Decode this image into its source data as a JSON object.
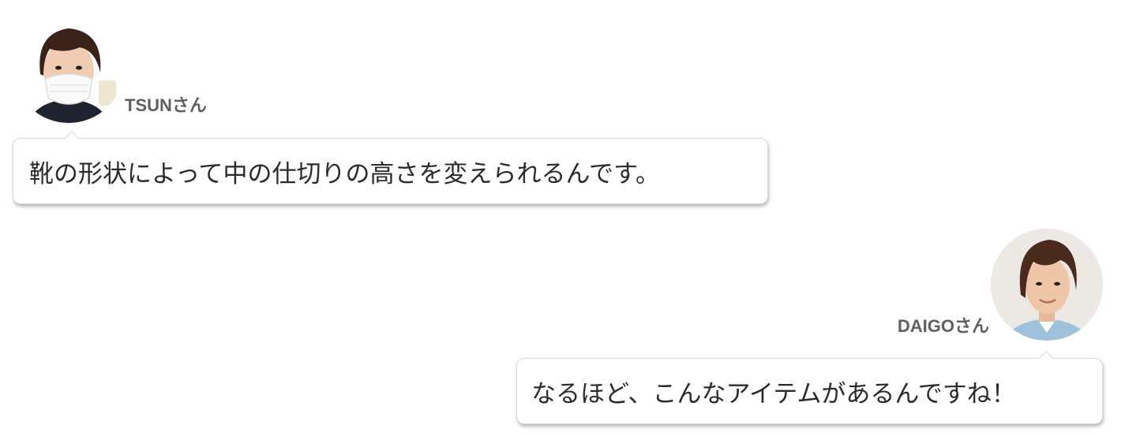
{
  "conversation": {
    "messages": [
      {
        "speaker": "TSUNさん",
        "side": "left",
        "avatar": "woman-with-face-mask-avatar",
        "text": "靴の形状によって中の仕切りの高さを変えられるんです。"
      },
      {
        "speaker": "DAIGOさん",
        "side": "right",
        "avatar": "man-smiling-avatar",
        "text": "なるほど、こんなアイテムがあるんですね！"
      }
    ]
  },
  "colors": {
    "name_text": "#5f5f5f",
    "message_text": "#2b2b2b",
    "bubble_border": "#d8d8d8",
    "background": "#ffffff"
  }
}
